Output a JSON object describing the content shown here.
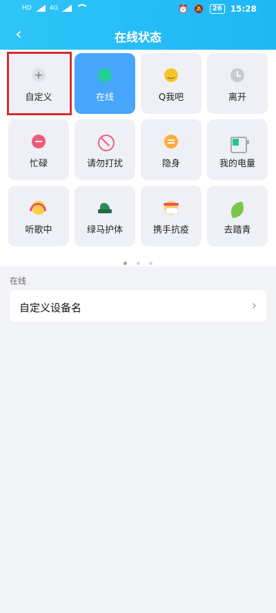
{
  "status_bar": {
    "left": "HD 4G HD",
    "battery": "26",
    "time": "15:28"
  },
  "header": {
    "title": "在线状态"
  },
  "statuses": [
    {
      "label": "自定义",
      "icon": "plus-icon"
    },
    {
      "label": "在线",
      "icon": "online-dot-icon",
      "selected": true
    },
    {
      "label": "Q我吧",
      "icon": "smile-icon"
    },
    {
      "label": "离开",
      "icon": "clock-icon"
    },
    {
      "label": "忙碌",
      "icon": "busy-minus-icon"
    },
    {
      "label": "请勿打扰",
      "icon": "do-not-disturb-icon"
    },
    {
      "label": "隐身",
      "icon": "invisible-icon"
    },
    {
      "label": "我的电量",
      "icon": "battery-icon"
    },
    {
      "label": "听歌中",
      "icon": "listening-music-icon"
    },
    {
      "label": "绿马护体",
      "icon": "green-horse-icon"
    },
    {
      "label": "携手抗疫",
      "icon": "face-mask-icon"
    },
    {
      "label": "去踏青",
      "icon": "leaf-icon"
    }
  ],
  "pagination": {
    "pages": 3,
    "current": 1
  },
  "section": {
    "label": "在线",
    "item_label": "自定义设备名"
  }
}
